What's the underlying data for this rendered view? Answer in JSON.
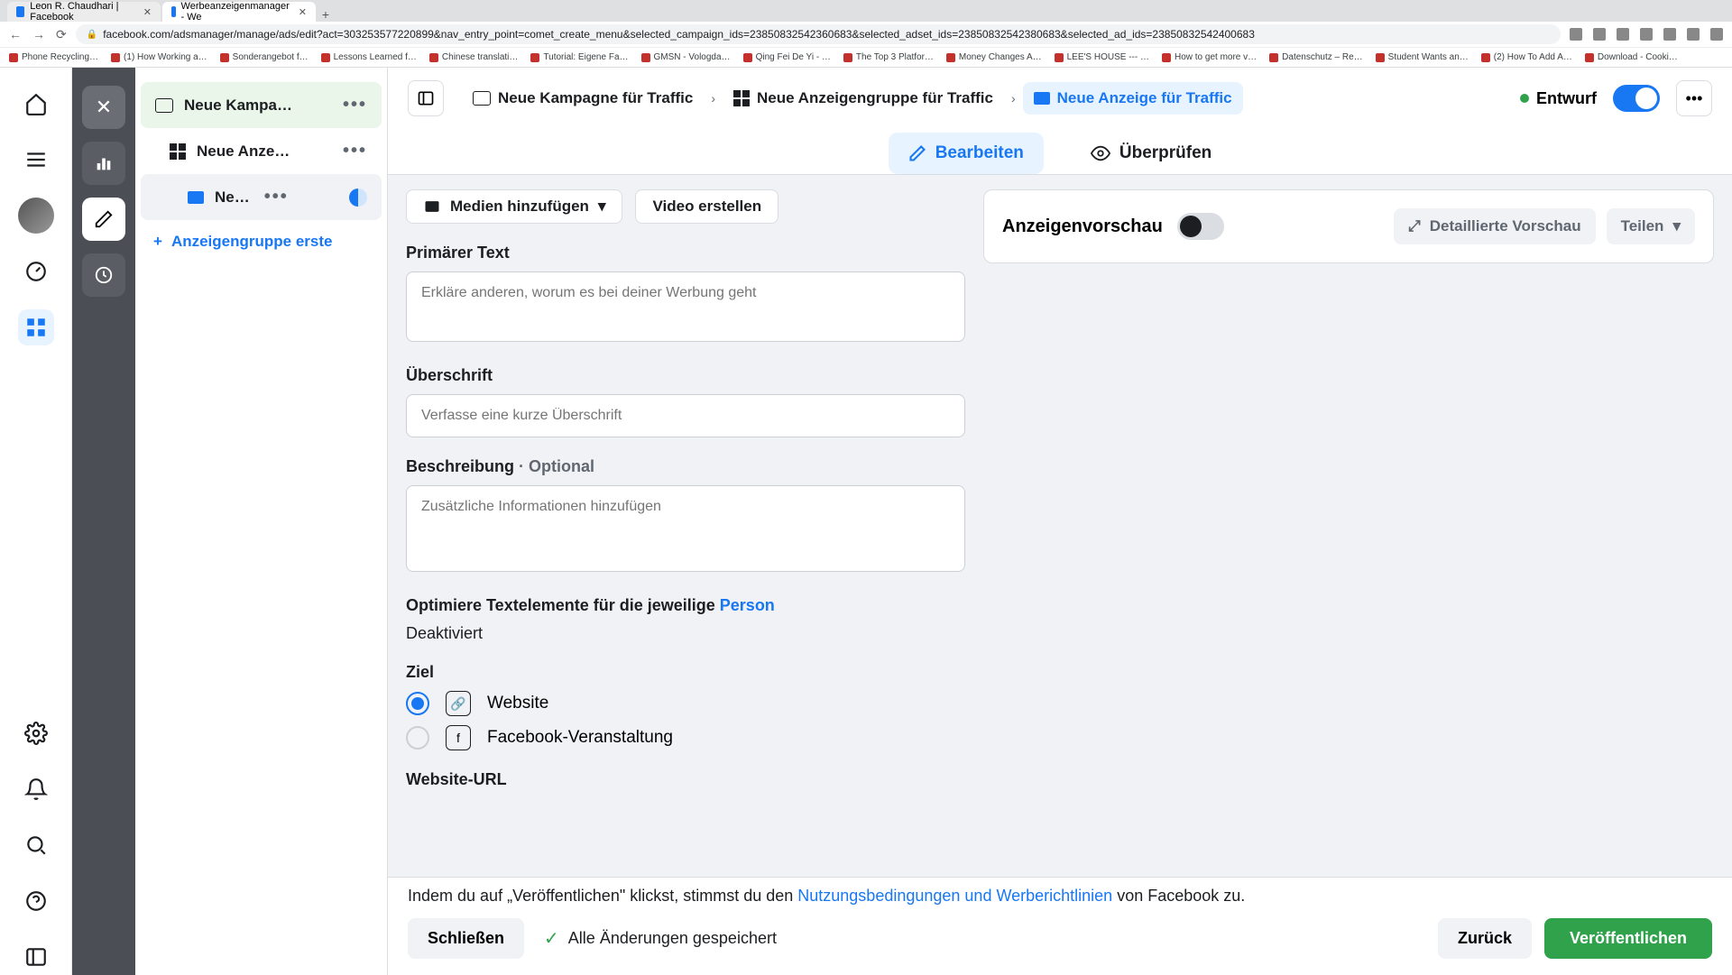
{
  "browser": {
    "tabs": [
      {
        "title": "Leon R. Chaudhari | Facebook"
      },
      {
        "title": "Werbeanzeigenmanager - We"
      }
    ],
    "url": "facebook.com/adsmanager/manage/ads/edit?act=303253577220899&nav_entry_point=comet_create_menu&selected_campaign_ids=23850832542360683&selected_adset_ids=23850832542380683&selected_ad_ids=23850832542400683",
    "bookmarks": [
      "Phone Recycling…",
      "(1) How Working a…",
      "Sonderangebot f…",
      "Lessons Learned f…",
      "Chinese translati…",
      "Tutorial: Eigene Fa…",
      "GMSN - Vologda…",
      "Qing Fei De Yi - …",
      "The Top 3 Platfor…",
      "Money Changes A…",
      "LEE'S HOUSE --- …",
      "How to get more v…",
      "Datenschutz – Re…",
      "Student Wants an…",
      "(2) How To Add A…",
      "Download - Cooki…"
    ]
  },
  "tree": {
    "campaign": "Neue Kampa…",
    "adset": "Neue Anze…",
    "ad": "Ne…",
    "add_group": "Anzeigengruppe erste"
  },
  "breadcrumb": {
    "campaign": "Neue Kampagne für Traffic",
    "adset": "Neue Anzeigengruppe für Traffic",
    "ad": "Neue Anzeige für Traffic"
  },
  "header": {
    "status": "Entwurf"
  },
  "tabs": {
    "edit": "Bearbeiten",
    "review": "Überprüfen"
  },
  "form": {
    "add_media": "Medien hinzufügen",
    "create_video": "Video erstellen",
    "primary_text_label": "Primärer Text",
    "primary_text_ph": "Erkläre anderen, worum es bei deiner Werbung geht",
    "headline_label": "Überschrift",
    "headline_ph": "Verfasse eine kurze Überschrift",
    "description_label": "Beschreibung",
    "optional_suffix": " · Optional",
    "description_ph": "Zusätzliche Informationen hinzufügen",
    "optimize_prefix": "Optimiere Textelemente für die jeweilige ",
    "optimize_link": "Person",
    "optimize_state": "Deaktiviert",
    "target_label": "Ziel",
    "target_website": "Website",
    "target_event": "Facebook-Veranstaltung",
    "website_url_label": "Website-URL"
  },
  "preview": {
    "title": "Anzeigenvorschau",
    "detailed": "Detaillierte Vorschau",
    "share": "Teilen"
  },
  "footer": {
    "terms_prefix": "Indem du auf „Veröffentlichen\" klickst, stimmst du den ",
    "terms_link": "Nutzungsbedingungen und Werberichtlinien",
    "terms_suffix": " von Facebook zu.",
    "close": "Schließen",
    "saved": "Alle Änderungen gespeichert",
    "back": "Zurück",
    "publish": "Veröffentlichen"
  }
}
